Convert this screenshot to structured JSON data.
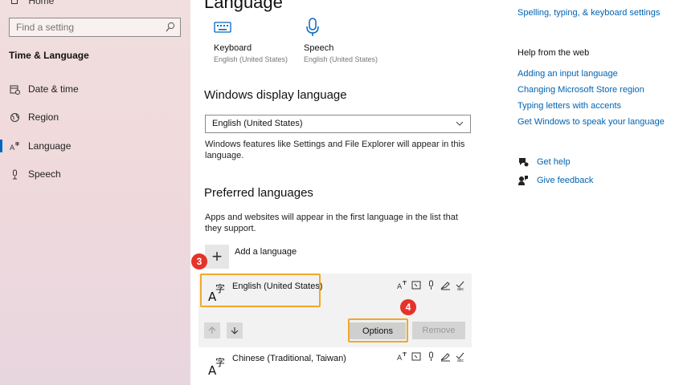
{
  "sidebar": {
    "home_label": "Home",
    "search_placeholder": "Find a setting",
    "section_title": "Time & Language",
    "items": [
      {
        "label": "Date & time",
        "icon": "calendar-clock-icon"
      },
      {
        "label": "Region",
        "icon": "globe-icon"
      },
      {
        "label": "Language",
        "icon": "language-icon",
        "active": true
      },
      {
        "label": "Speech",
        "icon": "microphone-icon"
      }
    ]
  },
  "main": {
    "title": "Language",
    "tiles": [
      {
        "label": "Keyboard",
        "sub": "English (United States)",
        "icon": "keyboard-icon"
      },
      {
        "label": "Speech",
        "sub": "English (United States)",
        "icon": "microphone-icon"
      }
    ],
    "display_language": {
      "heading": "Windows display language",
      "value": "English (United States)",
      "description": "Windows features like Settings and File Explorer will appear in this language."
    },
    "preferred": {
      "heading": "Preferred languages",
      "description": "Apps and websites will appear in the first language in the list that they support.",
      "add_label": "Add a language",
      "languages": [
        {
          "name": "English (United States)",
          "selected": true
        },
        {
          "name": "Chinese (Traditional, Taiwan)",
          "selected": false
        }
      ],
      "options_label": "Options",
      "remove_label": "Remove"
    },
    "badges": {
      "lang_badge": "3",
      "options_badge": "4"
    }
  },
  "right": {
    "top_link": "Spelling, typing, & keyboard settings",
    "help_heading": "Help from the web",
    "help_links": [
      "Adding an input language",
      "Changing Microsoft Store region",
      "Typing letters with accents",
      "Get Windows to speak your language"
    ],
    "get_help": "Get help",
    "give_feedback": "Give feedback"
  },
  "colors": {
    "accent": "#0067c0",
    "link": "#0063b1",
    "highlight": "#f0a92a",
    "badge": "#e5332a"
  }
}
